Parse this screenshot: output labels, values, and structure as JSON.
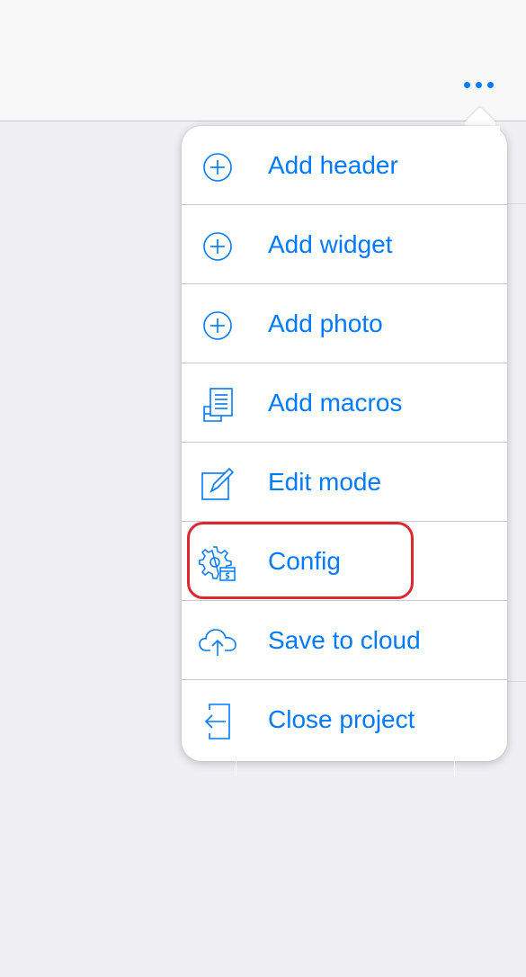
{
  "navbar": {
    "more_icon": "ellipsis-icon"
  },
  "colors": {
    "accent": "#007aff",
    "highlight": "#e0262e",
    "background": "#efeff4"
  },
  "menu": {
    "items": [
      {
        "label": "Add header",
        "icon": "plus-circle-icon"
      },
      {
        "label": "Add widget",
        "icon": "plus-circle-icon"
      },
      {
        "label": "Add photo",
        "icon": "plus-circle-icon"
      },
      {
        "label": "Add macros",
        "icon": "macros-document-icon"
      },
      {
        "label": "Edit mode",
        "icon": "edit-pencil-icon"
      },
      {
        "label": "Config",
        "icon": "gear-config-icon"
      },
      {
        "label": "Save to cloud",
        "icon": "cloud-upload-icon"
      },
      {
        "label": "Close project",
        "icon": "exit-arrow-icon"
      }
    ]
  }
}
